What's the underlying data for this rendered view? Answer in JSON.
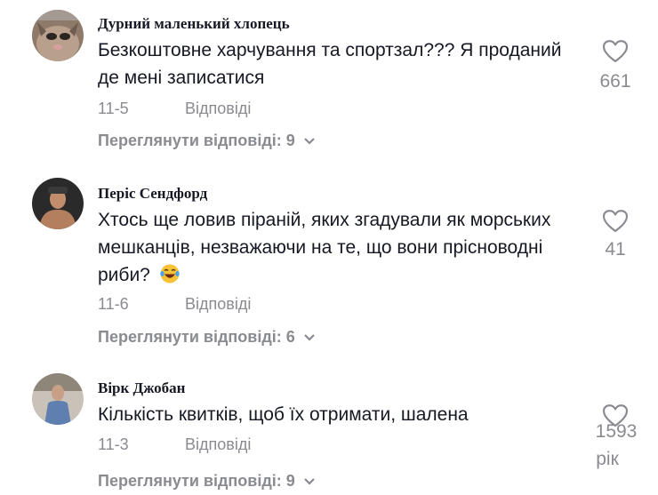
{
  "comments": [
    {
      "username": "Дурний маленький хлопець",
      "text": "Безкоштовне харчування та спортзал??? Я проданий де мені записатися",
      "date": "11-5",
      "reply_label": "Відповіді",
      "view_replies": "Переглянути відповіді: 9",
      "likes": "661"
    },
    {
      "username": "Періс Сендфорд",
      "text": "Хтось ще ловив піраній, яких згадували як морських мешканців, незважаючи на те, що вони прісноводні риби?",
      "emoji": "laughing-tears-emoji",
      "date": "11-6",
      "reply_label": "Відповіді",
      "view_replies": "Переглянути відповіді: 6",
      "likes": "41"
    },
    {
      "username": "Вірк Джобан",
      "text": "Кількість квитків, щоб їх отримати, шалена",
      "date": "11-3",
      "reply_label": "Відповіді",
      "view_replies": "Переглянути відповіді: 9",
      "likes": "1593",
      "likes_suffix": "рік"
    }
  ],
  "icons": {
    "like": "heart-outline-icon",
    "expand": "chevron-down-icon"
  },
  "colors": {
    "text": "#161823",
    "muted": "#8a8b91",
    "background": "#ffffff"
  }
}
